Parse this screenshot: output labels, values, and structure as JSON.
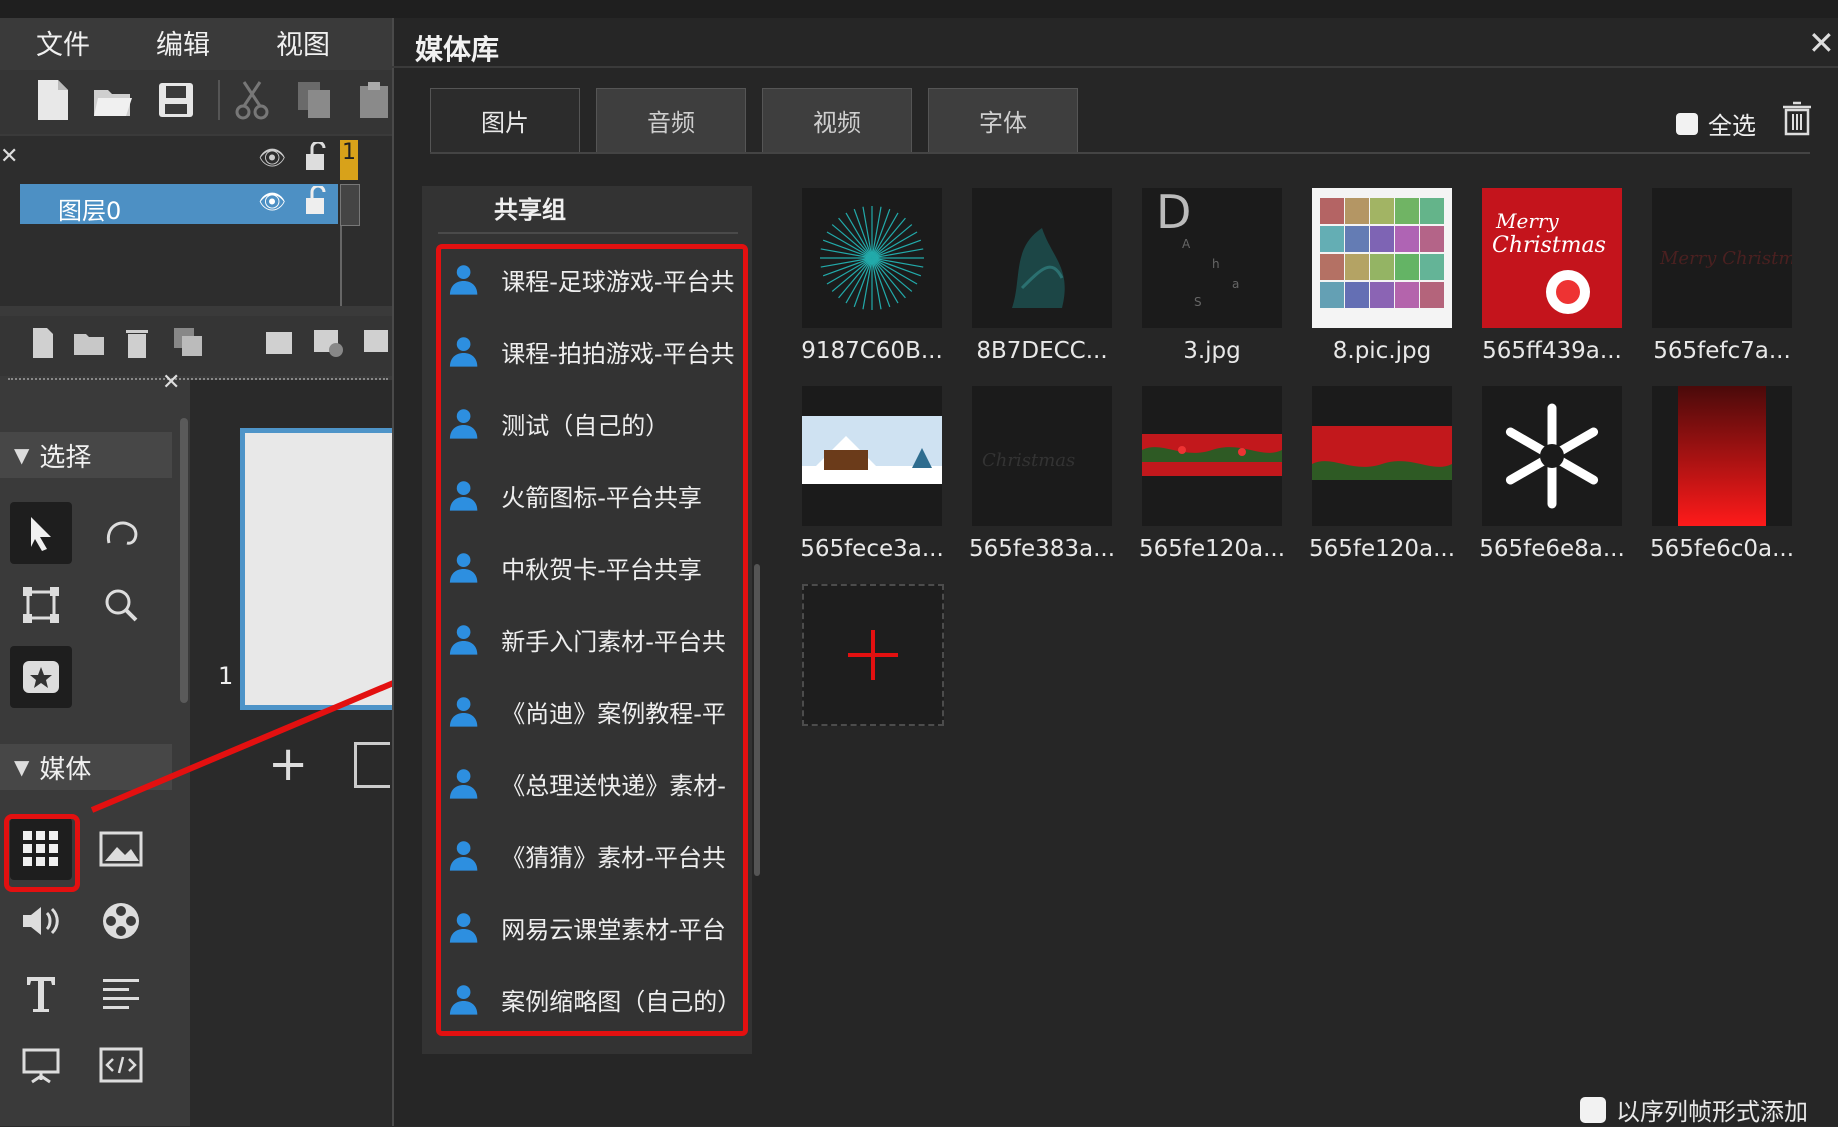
{
  "menu": [
    "文件",
    "编辑",
    "视图"
  ],
  "layers": {
    "layer_name": "图层0",
    "frame_marker": "1"
  },
  "tools": {
    "section_select": "选择",
    "section_media": "媒体"
  },
  "stage": {
    "frame_number": "1"
  },
  "dialog": {
    "title": "媒体库",
    "tabs": [
      "图片",
      "音频",
      "视频",
      "字体"
    ],
    "active_tab": "图片",
    "select_all": "全选",
    "group_header": "共享组",
    "groups": [
      "课程-足球游戏-平台共",
      "课程-拍拍游戏-平台共",
      "测试（自己的）",
      "火箭图标-平台共享",
      "中秋贺卡-平台共享",
      "新手入门素材-平台共",
      "《尚迪》案例教程-平",
      "《总理送快递》素材-",
      "《猜猜》素材-平台共",
      "网易云课堂素材-平台",
      "案例缩略图（自己的）"
    ],
    "images": [
      "9187C60B...",
      "8B7DECC...",
      "3.jpg",
      "8.pic.jpg",
      "565ff439a...",
      "565fefc7a...",
      "565fece3a...",
      "565fe383a...",
      "565fe120a...",
      "565fe120a...",
      "565fe6e8a...",
      "565fe6c0a..."
    ],
    "sequence_label": "以序列帧形式添加"
  },
  "colors": {
    "highlight": "#e31010",
    "layer_selected": "#4d90c4",
    "user_icon": "#2d8fe0"
  }
}
